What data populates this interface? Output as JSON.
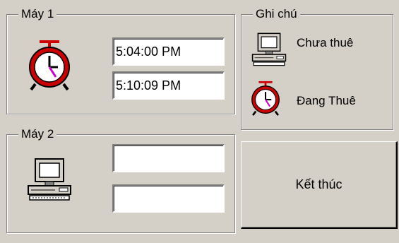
{
  "machine1": {
    "title": "Máy 1",
    "status_icon": "alarm-clock-icon",
    "start_time": "5:04:00 PM",
    "current_time": "5:10:09 PM"
  },
  "machine2": {
    "title": "Máy 2",
    "status_icon": "computer-icon",
    "start_time": "",
    "current_time": ""
  },
  "legend": {
    "title": "Ghi chú",
    "available_icon": "computer-icon",
    "available_label": "Chưa thuê",
    "rented_icon": "alarm-clock-icon",
    "rented_label": "Đang Thuê"
  },
  "actions": {
    "finish_label": "Kết thúc"
  },
  "colors": {
    "background": "#d4d0c8",
    "clock_red": "#cc0000",
    "clock_hand_accent": "#cc00cc"
  }
}
